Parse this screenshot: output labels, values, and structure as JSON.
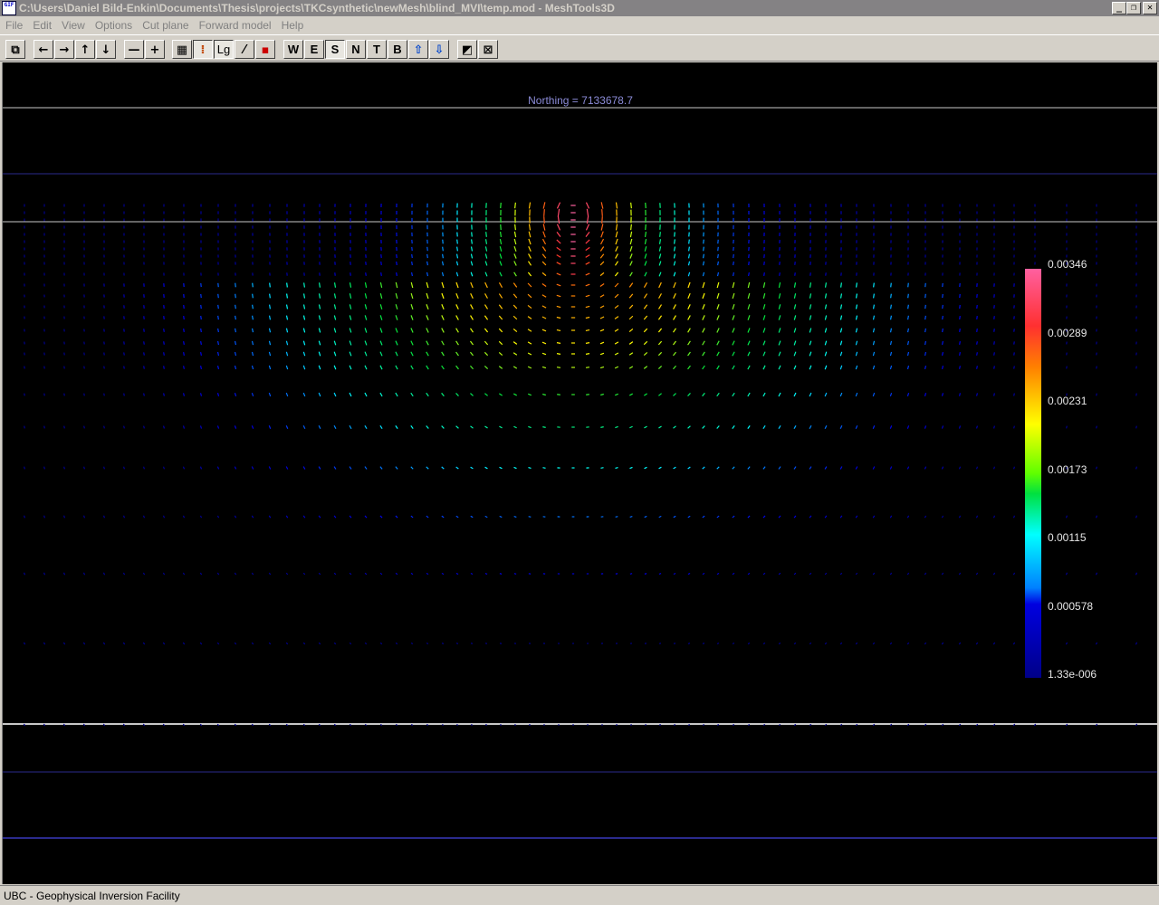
{
  "window": {
    "title": "C:\\Users\\Daniel Bild-Enkin\\Documents\\Thesis\\projects\\TKCsynthetic\\newMesh\\blind_MVI\\temp.mod - MeshTools3D",
    "app_icon_text": "GIF",
    "minimize_glyph": "_",
    "maximize_glyph": "❐",
    "close_glyph": "✕"
  },
  "menu": [
    "File",
    "Edit",
    "View",
    "Options",
    "Cut plane",
    "Forward model",
    "Help"
  ],
  "toolbar": {
    "copy": "⧉",
    "left": "←",
    "right": "→",
    "up": "↑",
    "down": "↓",
    "zoom_out": "—",
    "zoom_in": "+",
    "grid": "▦",
    "colorbar": "⁞",
    "log_scale": "Lg",
    "slash": "⁄",
    "palette": "▪",
    "view_w": "W",
    "view_e": "E",
    "view_s": "S",
    "view_n": "N",
    "view_t": "T",
    "view_b": "B",
    "export_up": "⇧",
    "export_down": "⇩",
    "box1": "◩",
    "box2": "⊠"
  },
  "canvas": {
    "northing_label": "Northing =  7133678.7"
  },
  "colorbar": {
    "labels": [
      "0.00346",
      "0.00289",
      "0.00231",
      "0.00173",
      "0.00115",
      "0.000578",
      "1.33e-006"
    ],
    "max": 0.00346,
    "min": 1.33e-06
  },
  "status": {
    "text": "UBC - Geophysical Inversion Facility"
  },
  "colors": {
    "background": "#000000",
    "mesh_line": "#2a2a8c",
    "section_line": "#c8c8c8"
  }
}
